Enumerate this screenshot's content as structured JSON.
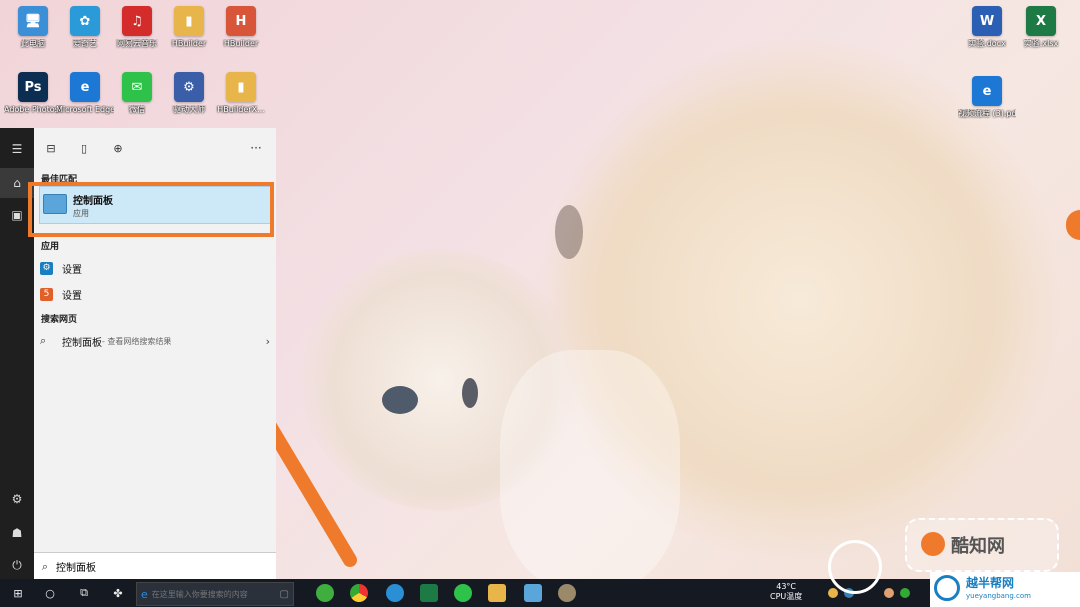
{
  "desktop": {
    "icons_left": [
      {
        "label": "此电脑",
        "color": "#3b8fd6",
        "glyph": "🖥"
      },
      {
        "label": "爱奇艺",
        "color": "#2a9ad8",
        "glyph": "✿"
      },
      {
        "label": "网易云音乐",
        "color": "#d42b2b",
        "glyph": "♫"
      },
      {
        "label": "HBuilder",
        "color": "#e8b54a",
        "glyph": "▮"
      },
      {
        "label": "HBuilder",
        "color": "#d9553a",
        "glyph": "H"
      },
      {
        "label": "Adobe Photosh...",
        "color": "#0b2e52",
        "glyph": "Ps"
      },
      {
        "label": "Microsoft Edge",
        "color": "#1c78d4",
        "glyph": "e"
      },
      {
        "label": "微信",
        "color": "#2ec24a",
        "glyph": "✉"
      },
      {
        "label": "驱动大师",
        "color": "#3a5fa8",
        "glyph": "⚙"
      },
      {
        "label": "HBuilderX...",
        "color": "#e8b54a",
        "glyph": "▮"
      }
    ],
    "icons_right": [
      {
        "label": "实验.docx",
        "color": "#2b5fb3",
        "glyph": "W"
      },
      {
        "label": "实验.xlsx",
        "color": "#1e7a45",
        "glyph": "X"
      },
      {
        "label": "视频流程 (3).pdf",
        "color": "#1c78d4",
        "glyph": "e"
      }
    ]
  },
  "start_menu": {
    "toolbar": {
      "apps_icon": "apps-icon",
      "document_icon": "document-icon",
      "web_icon": "globe-icon",
      "more": "···"
    },
    "best_match_header": "最佳匹配",
    "best_match": {
      "title": "控制面板",
      "subtitle": "应用",
      "icon": "control-panel-icon"
    },
    "apps_header": "应用",
    "apps": [
      {
        "label": "设置",
        "icon": "gear-icon",
        "color": "#1a7fc1"
      },
      {
        "label": "设置",
        "icon": "app-icon",
        "color": "#e0602a"
      }
    ],
    "web_header": "搜索网页",
    "web_result": {
      "label": "控制面板",
      "suffix": " - 查看网络搜索结果"
    },
    "search_value": "控制面板"
  },
  "taskbar": {
    "search_placeholder": "在这里输入你要搜索的内容",
    "temperature": "43°C",
    "cpu_label": "CPU温度"
  },
  "watermark": {
    "brand": "酷知网",
    "site": "yueyangbang.com",
    "slogan": "越半帮网"
  },
  "colors": {
    "highlight": "#f07a2b",
    "selection": "#cde8f6",
    "taskbar": "#151a22"
  }
}
